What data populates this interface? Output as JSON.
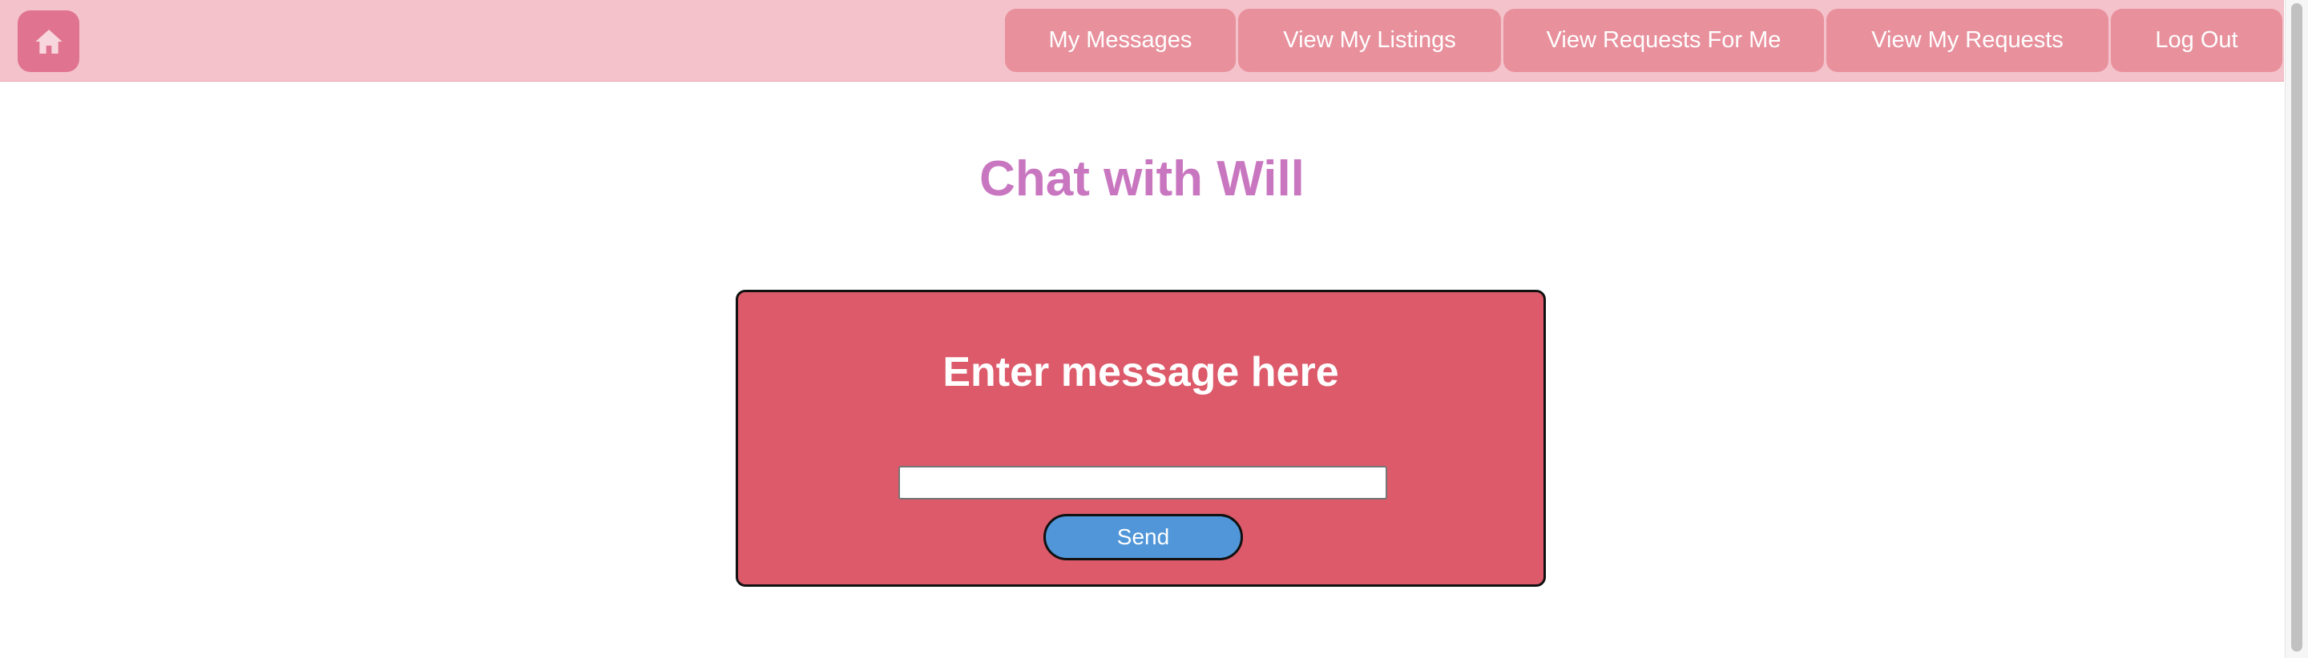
{
  "navbar": {
    "home_icon": "home-icon",
    "items": [
      {
        "label": "My Messages"
      },
      {
        "label": "View My Listings"
      },
      {
        "label": "View Requests For Me"
      },
      {
        "label": "View My Requests"
      },
      {
        "label": "Log Out"
      }
    ]
  },
  "main": {
    "title": "Chat with Will",
    "card": {
      "heading": "Enter message here",
      "input_value": "",
      "send_label": "Send"
    }
  },
  "colors": {
    "navbar_bg": "#f4c2cb",
    "nav_item_bg": "#e8919d",
    "home_button_bg": "#e0738f",
    "title": "#c976c0",
    "card_bg": "#dc5a6a",
    "send_button_bg": "#5096d8"
  }
}
